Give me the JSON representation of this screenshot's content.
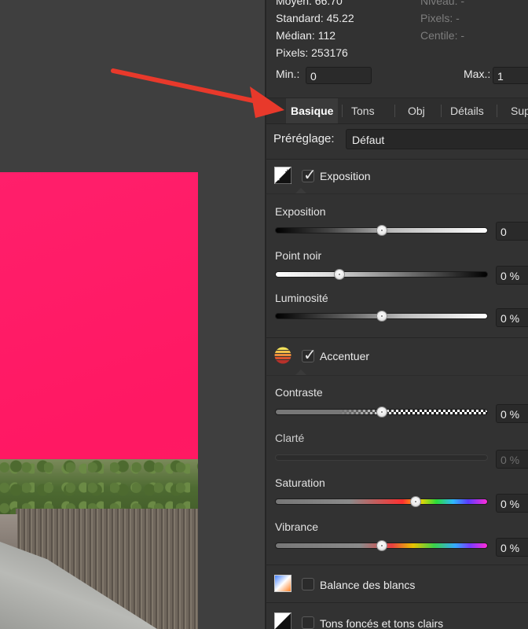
{
  "stats": {
    "moyen": "Moyen: 66.70",
    "standard": "Standard: 45.22",
    "median": "Médian: 112",
    "pixels": "Pixels: 253176",
    "niveau": "Niveau: -",
    "pixels_right": "Pixels: -",
    "centile": "Centile: -"
  },
  "range": {
    "min_label": "Min.:",
    "min_value": "0",
    "max_label": "Max.:",
    "max_value": "1"
  },
  "tabs": [
    {
      "label": "Basique",
      "active": true
    },
    {
      "label": "Tons",
      "active": false
    },
    {
      "label": "Obj",
      "active": false
    },
    {
      "label": "Détails",
      "active": false
    },
    {
      "label": "Sup",
      "active": false
    }
  ],
  "preset": {
    "label": "Préréglage:",
    "value": "Défaut"
  },
  "sections": {
    "exposition": {
      "title": "Exposition",
      "checked": true,
      "sliders": [
        {
          "label": "Exposition",
          "value": "0",
          "level": 0.5
        },
        {
          "label": "Point noir",
          "value": "0 %",
          "level": 0.3
        },
        {
          "label": "Luminosité",
          "value": "0 %",
          "level": 0.5
        }
      ]
    },
    "accentuer": {
      "title": "Accentuer",
      "checked": true,
      "sliders": [
        {
          "label": "Contraste",
          "value": "0 %",
          "level": 0.5
        },
        {
          "label": "Clarté",
          "value": "0 %",
          "disabled": true
        },
        {
          "label": "Saturation",
          "value": "0 %",
          "level": 0.66
        },
        {
          "label": "Vibrance",
          "value": "0 %",
          "level": 0.5
        }
      ]
    },
    "balance": {
      "title": "Balance des blancs",
      "checked": false
    },
    "tons": {
      "title": "Tons foncés et tons clairs",
      "checked": false
    }
  },
  "colors": {
    "arrow": "#e8392b",
    "photo_magenta": "#ff1f6b",
    "panel_bg": "#323232"
  }
}
